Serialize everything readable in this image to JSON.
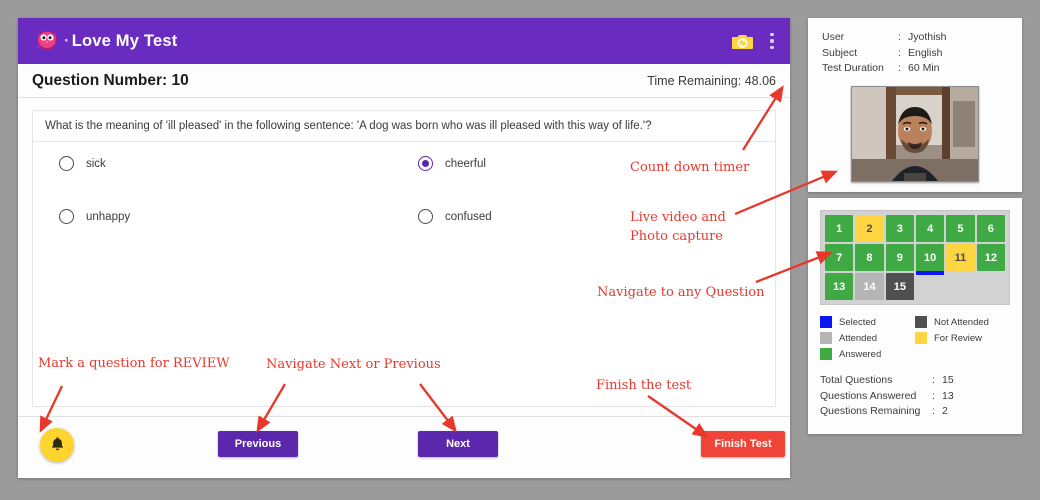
{
  "app": {
    "title": "Love My Test",
    "logo_icon": "owl-mascot-icon",
    "camera_icon": "camera-icon",
    "menu_icon": "kebab-menu-icon"
  },
  "question_header": {
    "number_label": "Question Number: 10",
    "timer_label": "Time Remaining: 48.06"
  },
  "question": {
    "text": "What is the meaning of 'ill pleased' in the following sentence: 'A dog was born who was ill pleased with this way of life.'?",
    "options": [
      {
        "label": "sick",
        "selected": false
      },
      {
        "label": "cheerful",
        "selected": true
      },
      {
        "label": "unhappy",
        "selected": false
      },
      {
        "label": "confused",
        "selected": false
      }
    ]
  },
  "footer": {
    "review_icon": "bell-icon",
    "previous_label": "Previous",
    "next_label": "Next",
    "finish_label": "Finish Test"
  },
  "sidebar": {
    "info": [
      {
        "key": "User",
        "value": "Jyothish"
      },
      {
        "key": "Subject",
        "value": "English"
      },
      {
        "key": "Test Duration",
        "value": "60 Min"
      }
    ],
    "photo_alt": "webcam-photo",
    "grid": [
      {
        "n": "1",
        "state": "answered",
        "selected": false
      },
      {
        "n": "2",
        "state": "review",
        "selected": false
      },
      {
        "n": "3",
        "state": "answered",
        "selected": false
      },
      {
        "n": "4",
        "state": "answered",
        "selected": false
      },
      {
        "n": "5",
        "state": "answered",
        "selected": false
      },
      {
        "n": "6",
        "state": "answered",
        "selected": false
      },
      {
        "n": "7",
        "state": "answered",
        "selected": false
      },
      {
        "n": "8",
        "state": "answered",
        "selected": false
      },
      {
        "n": "9",
        "state": "answered",
        "selected": false
      },
      {
        "n": "10",
        "state": "answered",
        "selected": true
      },
      {
        "n": "11",
        "state": "review",
        "selected": false
      },
      {
        "n": "12",
        "state": "answered",
        "selected": false
      },
      {
        "n": "13",
        "state": "answered",
        "selected": false
      },
      {
        "n": "14",
        "state": "attended",
        "selected": false
      },
      {
        "n": "15",
        "state": "notattended",
        "selected": false
      }
    ],
    "legend": [
      {
        "label": "Selected",
        "color": "#0b16f0"
      },
      {
        "label": "Not Attended",
        "color": "#4f4f4f"
      },
      {
        "label": "Attended",
        "color": "#b5b5b5"
      },
      {
        "label": "For Review",
        "color": "#ffd642"
      },
      {
        "label": "Answered",
        "color": "#3fa943"
      }
    ],
    "totals": [
      {
        "key": "Total Questions",
        "value": "15"
      },
      {
        "key": "Questions Answered",
        "value": "13"
      },
      {
        "key": "Questions Remaining",
        "value": "2"
      }
    ]
  },
  "annotations": [
    {
      "id": "timer",
      "text": "Count down timer"
    },
    {
      "id": "video",
      "text": "Live video and\nPhoto capture"
    },
    {
      "id": "navigate",
      "text": "Navigate to any Question"
    },
    {
      "id": "review",
      "text": "Mark a question for REVIEW"
    },
    {
      "id": "nextprev",
      "text": "Navigate Next or Previous"
    },
    {
      "id": "finish",
      "text": "Finish the test"
    }
  ],
  "colors": {
    "brand_purple": "#6a2cc0",
    "button_purple": "#5b27ad",
    "finish_red": "#f04438",
    "annotation_red": "#e8372b",
    "bell_yellow": "#ffd42e",
    "answered_green": "#3fa943",
    "review_yellow": "#ffd642",
    "selected_blue": "#0b16f0",
    "page_background": "#9b9b9b"
  }
}
